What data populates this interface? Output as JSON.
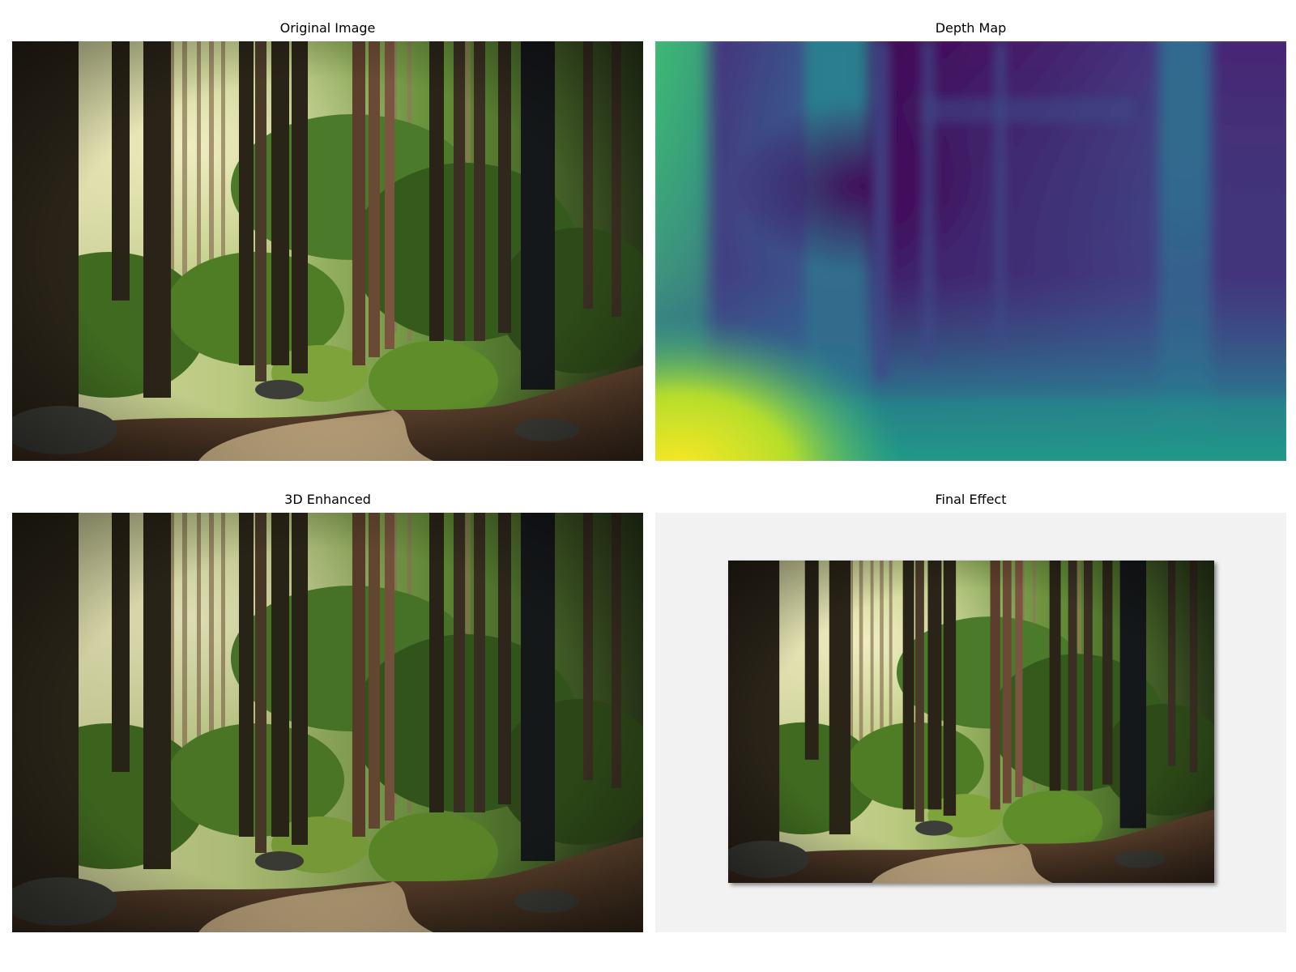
{
  "panels": {
    "original": {
      "title": "Original Image"
    },
    "depth": {
      "title": "Depth Map"
    },
    "enhanced": {
      "title": "3D Enhanced"
    },
    "final": {
      "title": "Final Effect"
    }
  },
  "colors": {
    "depth_far": "#440154",
    "depth_mid": "#3b528b",
    "depth_near": "#21918c",
    "depth_closest": "#fde725",
    "forest_dark": "#1b1e16",
    "forest_green": "#3e6b22",
    "path": "#b79a76"
  }
}
